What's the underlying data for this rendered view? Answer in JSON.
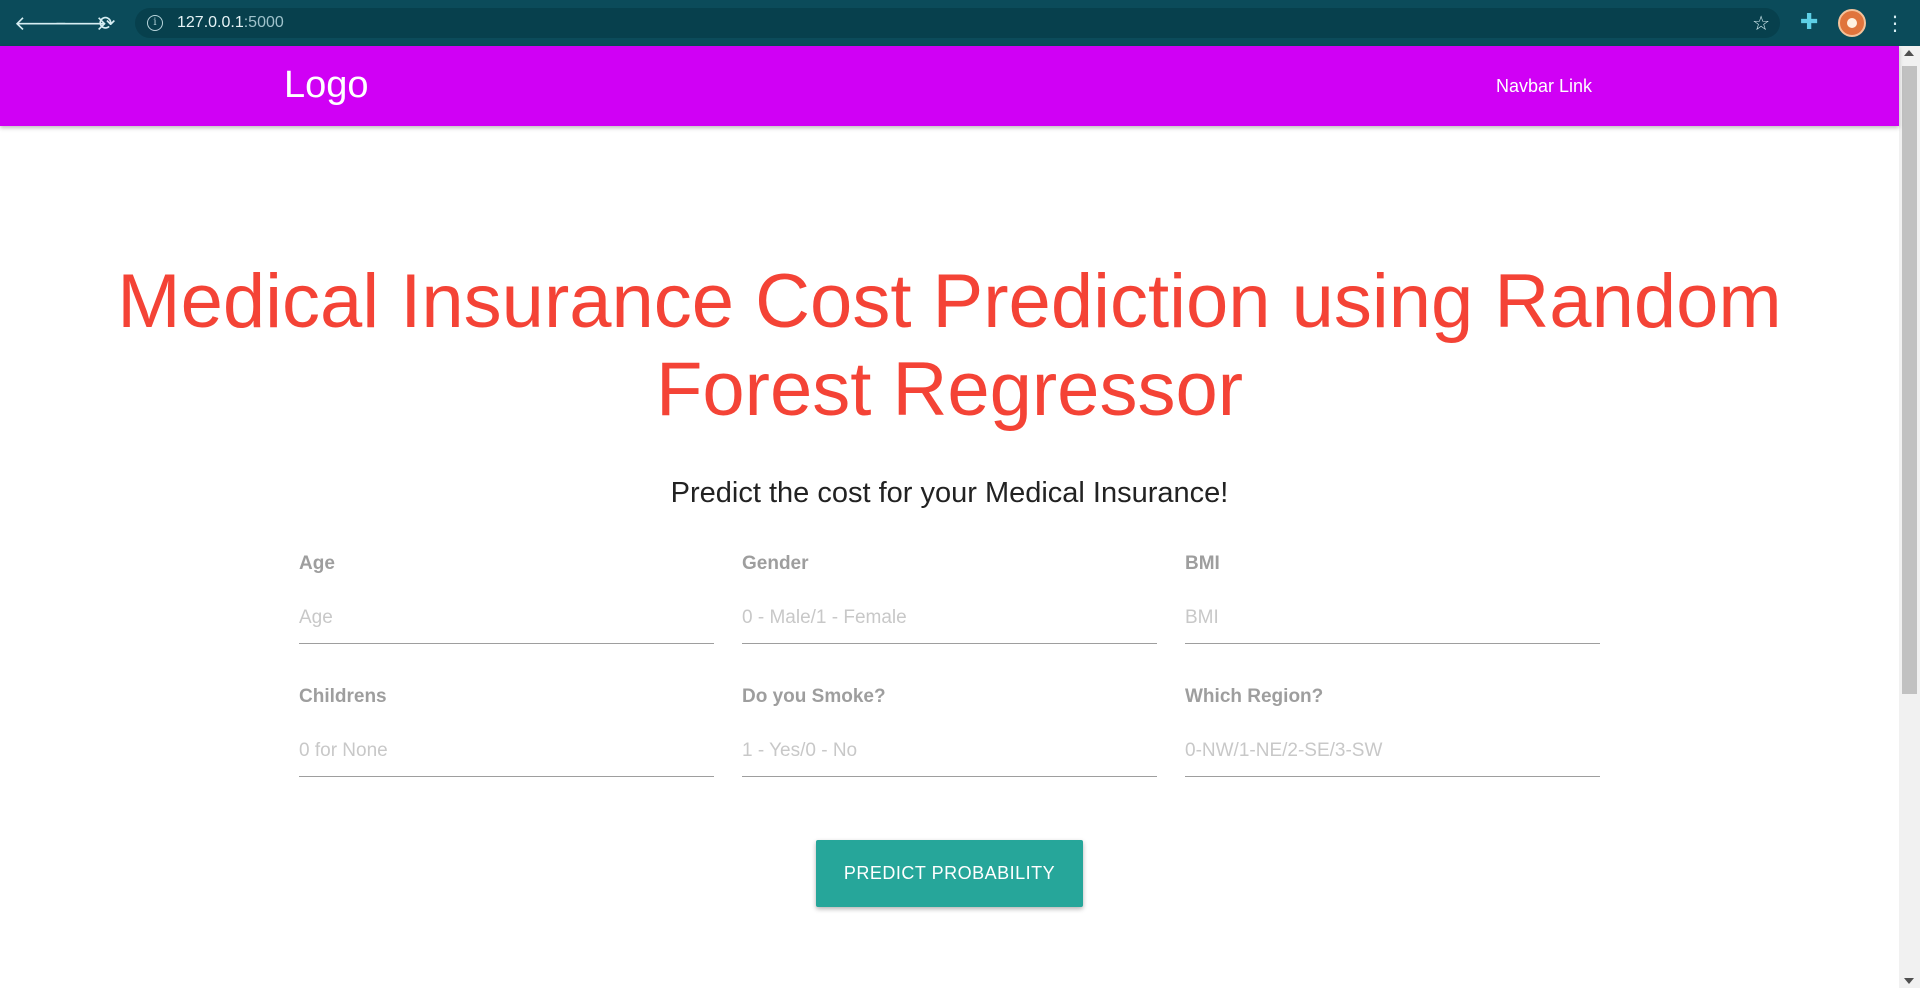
{
  "browser": {
    "url_host": "127.0.0.1",
    "url_port": ":5000",
    "back_glyph": "🡐",
    "forward_glyph": "🡒",
    "reload_glyph": "⟳",
    "info_glyph": "i",
    "star_glyph": "☆",
    "extensions_glyph": "✚",
    "menu_glyph": "⋮"
  },
  "navbar": {
    "logo": "Logo",
    "link": "Navbar Link",
    "color": "#d000f5"
  },
  "hero": {
    "title": "Medical Insurance Cost Prediction using Random Forest Regressor",
    "subtitle": "Predict the cost for your Medical Insurance!",
    "title_color": "#f44336"
  },
  "form": {
    "fields": [
      {
        "label": "Age",
        "placeholder": "Age",
        "value": ""
      },
      {
        "label": "Gender",
        "placeholder": "0 - Male/1 - Female",
        "value": ""
      },
      {
        "label": "BMI",
        "placeholder": "BMI",
        "value": ""
      },
      {
        "label": "Childrens",
        "placeholder": "0 for None",
        "value": ""
      },
      {
        "label": "Do you Smoke?",
        "placeholder": "1 - Yes/0 - No",
        "value": ""
      },
      {
        "label": "Which Region?",
        "placeholder": "0-NW/1-NE/2-SE/3-SW",
        "value": ""
      }
    ],
    "submit_label": "PREDICT PROBABILITY",
    "submit_color": "#26a69a"
  }
}
